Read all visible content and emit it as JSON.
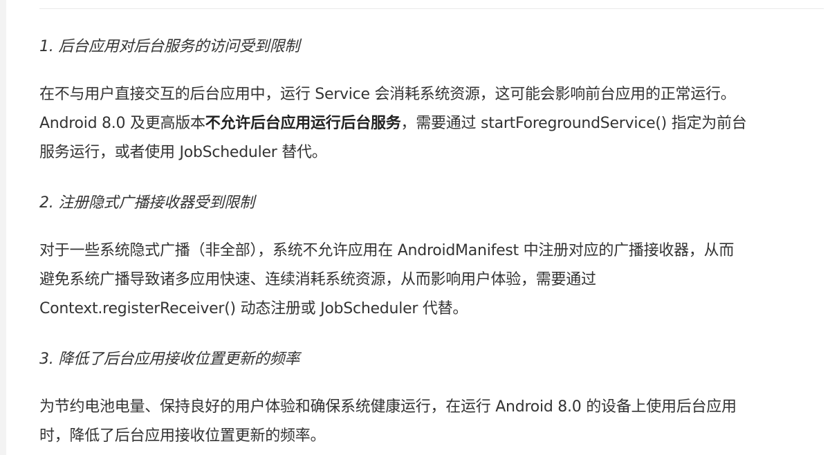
{
  "article": {
    "section1": {
      "heading": "1. 后台应用对后台服务的访问受到限制",
      "paragraph": {
        "line1": "在不与用户直接交互的后台应用中，运行 Service 会消耗系统资源，这可能会影响前台应用的正常运行。",
        "line2_prefix": "Android 8.0 及更高版本",
        "line2_bold": "不允许后台应用运行后台服务",
        "line2_suffix": "，需要通过 startForegroundService() 指定为前台",
        "line3": "服务运行，或者使用 JobScheduler 替代。"
      }
    },
    "section2": {
      "heading": "2. 注册隐式广播接收器受到限制",
      "paragraph": {
        "line1": "对于一些系统隐式广播（非全部），系统不允许应用在 AndroidManifest 中注册对应的广播接收器，从而",
        "line2": "避免系统广播导致诸多应用快速、连续消耗系统资源，从而影响用户体验，需要通过",
        "line3": "Context.registerReceiver() 动态注册或 JobScheduler 代替。"
      }
    },
    "section3": {
      "heading": "3. 降低了后台应用接收位置更新的频率",
      "paragraph": {
        "line1": "为节约电池电量、保持良好的用户体验和确保系统健康运行，在运行 Android 8.0 的设备上使用后台应用",
        "line2": "时，降低了后台应用接收位置更新的频率。"
      }
    }
  },
  "colors": {
    "text": "#333333",
    "background": "#ffffff",
    "left_rail": "#f3f3f3",
    "divider": "#e9e9e9"
  }
}
